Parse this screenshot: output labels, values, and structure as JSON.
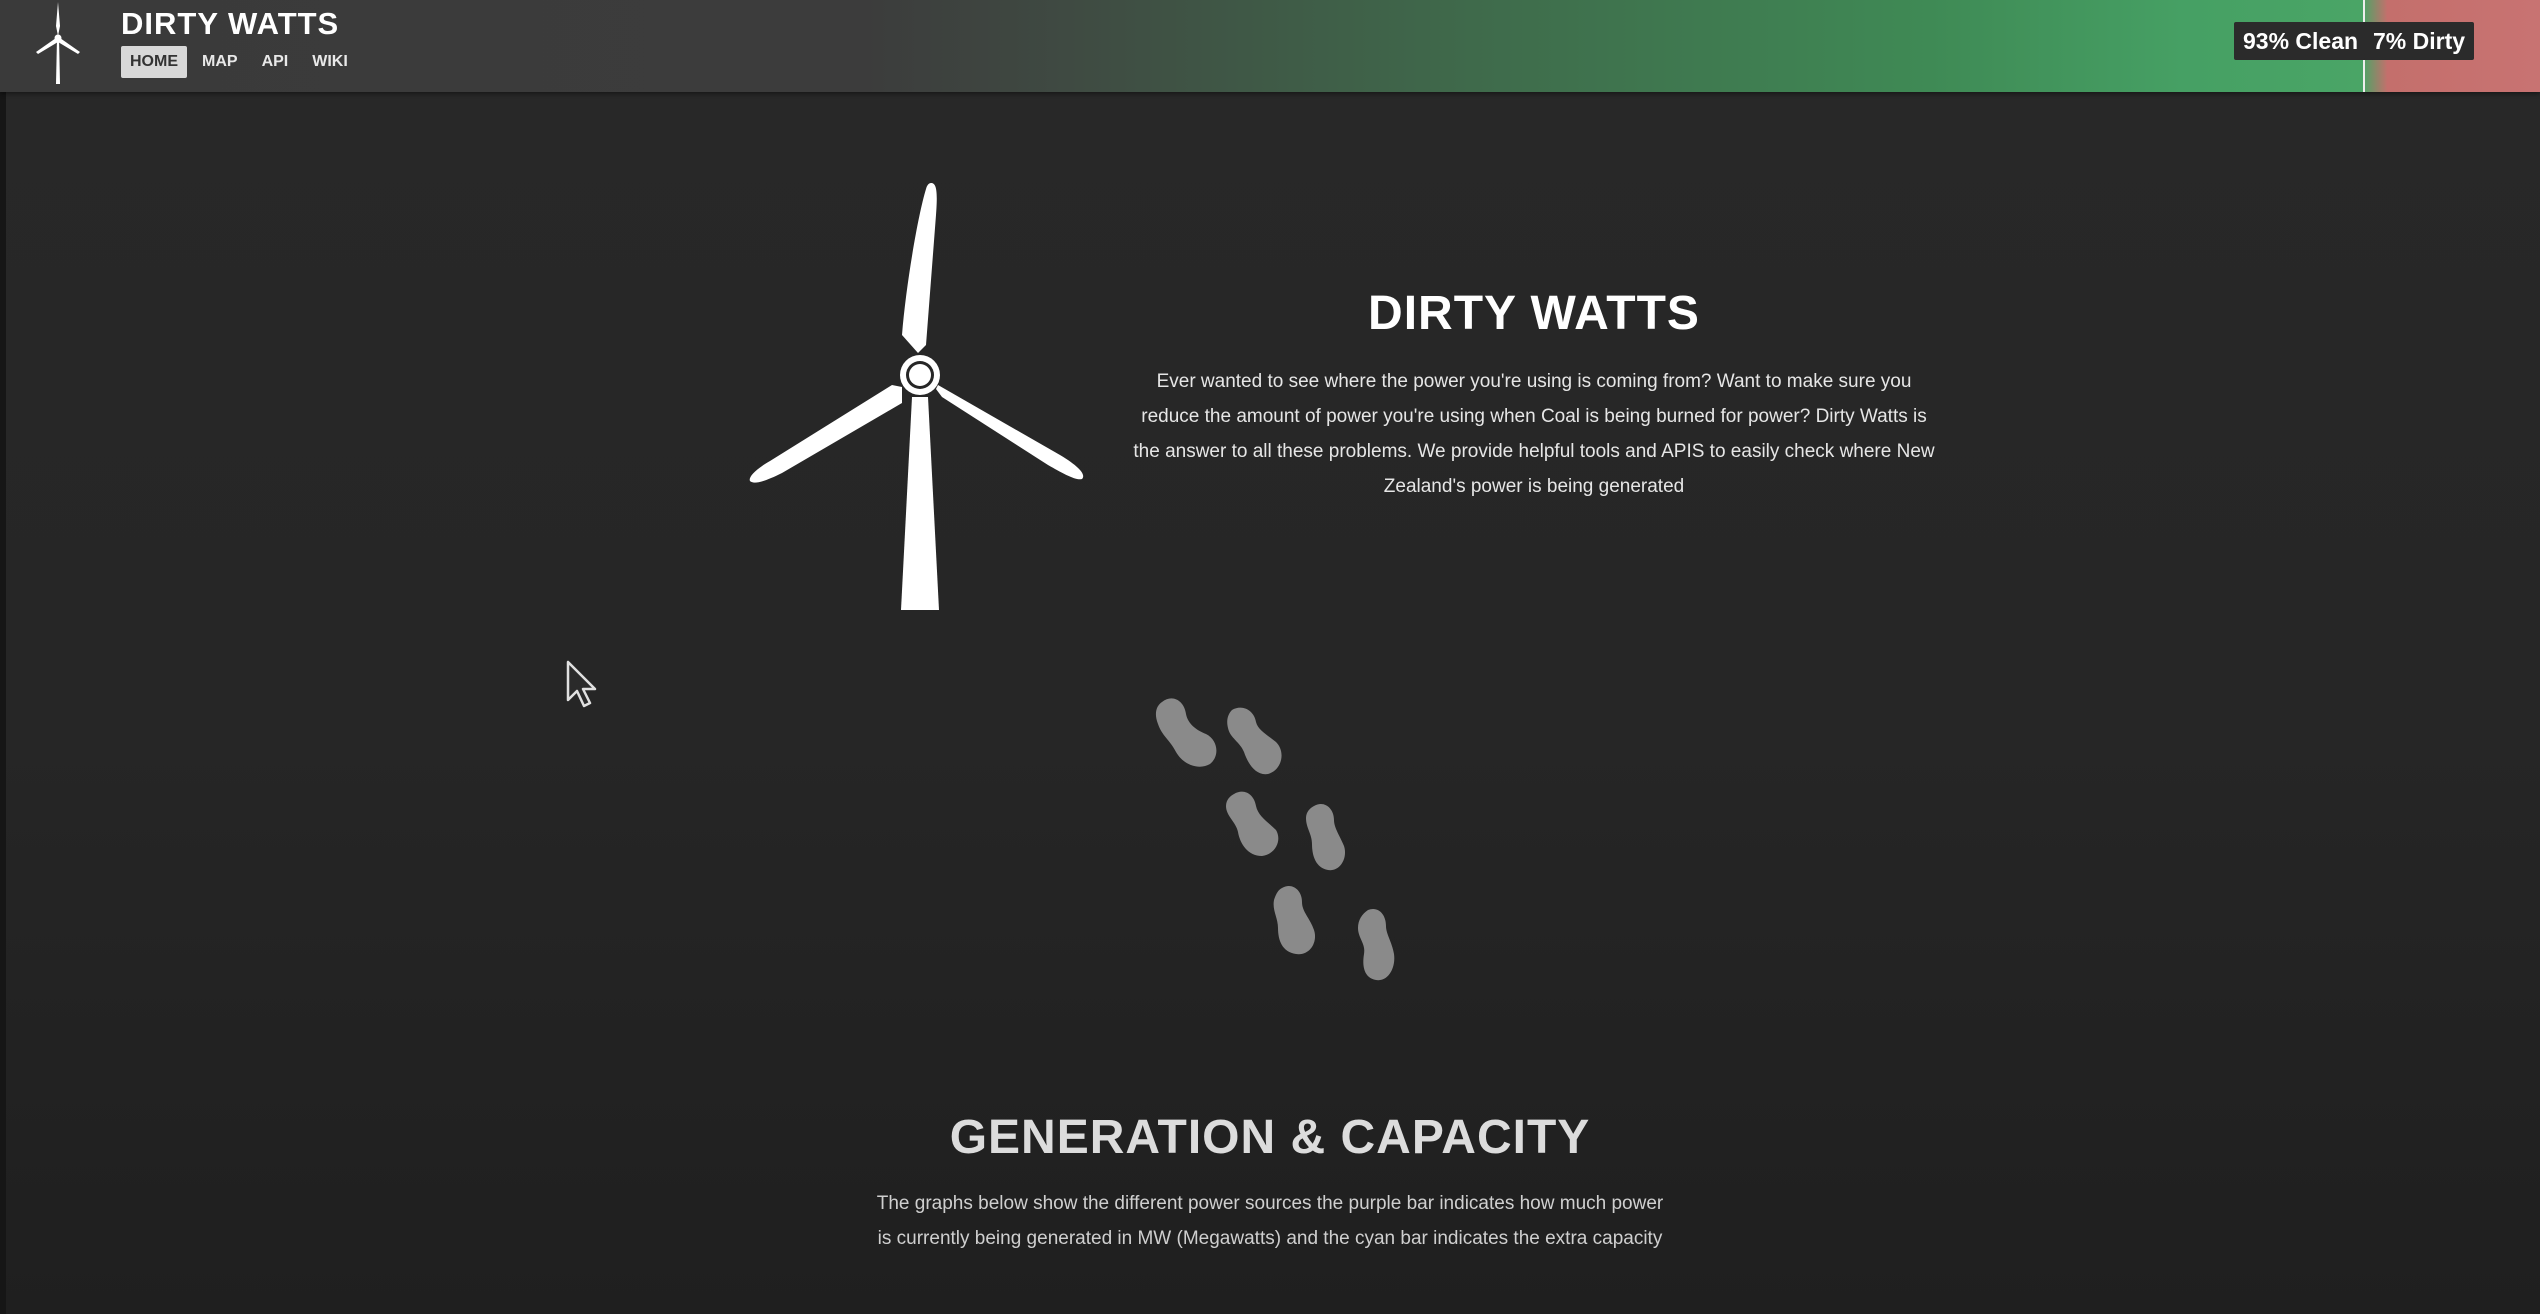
{
  "header": {
    "brand": "DIRTY WATTS",
    "nav": [
      {
        "label": "HOME",
        "active": true
      },
      {
        "label": "MAP",
        "active": false
      },
      {
        "label": "API",
        "active": false
      },
      {
        "label": "WIKI",
        "active": false
      }
    ],
    "clean_label": "93% Clean",
    "dirty_label": "7% Dirty",
    "clean_percent": 93,
    "dirty_percent": 7,
    "clean_color": "#4aa566",
    "dirty_color": "#c87372"
  },
  "hero": {
    "title": "DIRTY WATTS",
    "description": "Ever wanted to see where the power you're using is coming from? Want to make sure you reduce the amount of power you're using when Coal is being burned for power? Dirty Watts is the answer to all these problems. We provide helpful tools and APIS to easily check where New Zealand's power is being generated",
    "icon": "wind-turbine-icon"
  },
  "map": {
    "icon": "new-zealand-map-icon"
  },
  "generation": {
    "title": "GENERATION & CAPACITY",
    "description": "The graphs below show the different power sources the purple bar indicates how much power is currently being generated in MW (Megawatts) and the cyan bar indicates the extra capacity"
  }
}
